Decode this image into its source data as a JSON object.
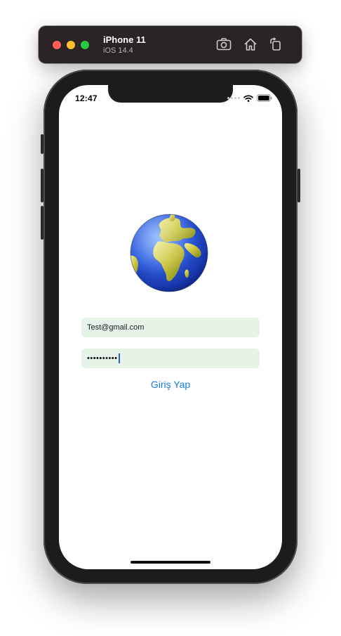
{
  "simulator": {
    "device_name": "iPhone 11",
    "os_version": "iOS 14.4",
    "toolbar_buttons": [
      {
        "icon": "camera-icon",
        "action": "screenshot"
      },
      {
        "icon": "home-icon",
        "action": "home"
      },
      {
        "icon": "rotate-icon",
        "action": "rotate"
      }
    ]
  },
  "status_bar": {
    "time": "12:47",
    "icons": [
      "signal-dots-icon",
      "wifi-icon",
      "battery-icon"
    ]
  },
  "app": {
    "logo": "globe-emoji-icon",
    "email": {
      "value": "Test@gmail.com"
    },
    "password": {
      "masked_value": "••••••••••"
    },
    "login_button": "Giriş Yap"
  },
  "colors": {
    "accent": "#1a7ae0",
    "field_background": "#e6f4e8",
    "caret": "#2f5ad8"
  }
}
